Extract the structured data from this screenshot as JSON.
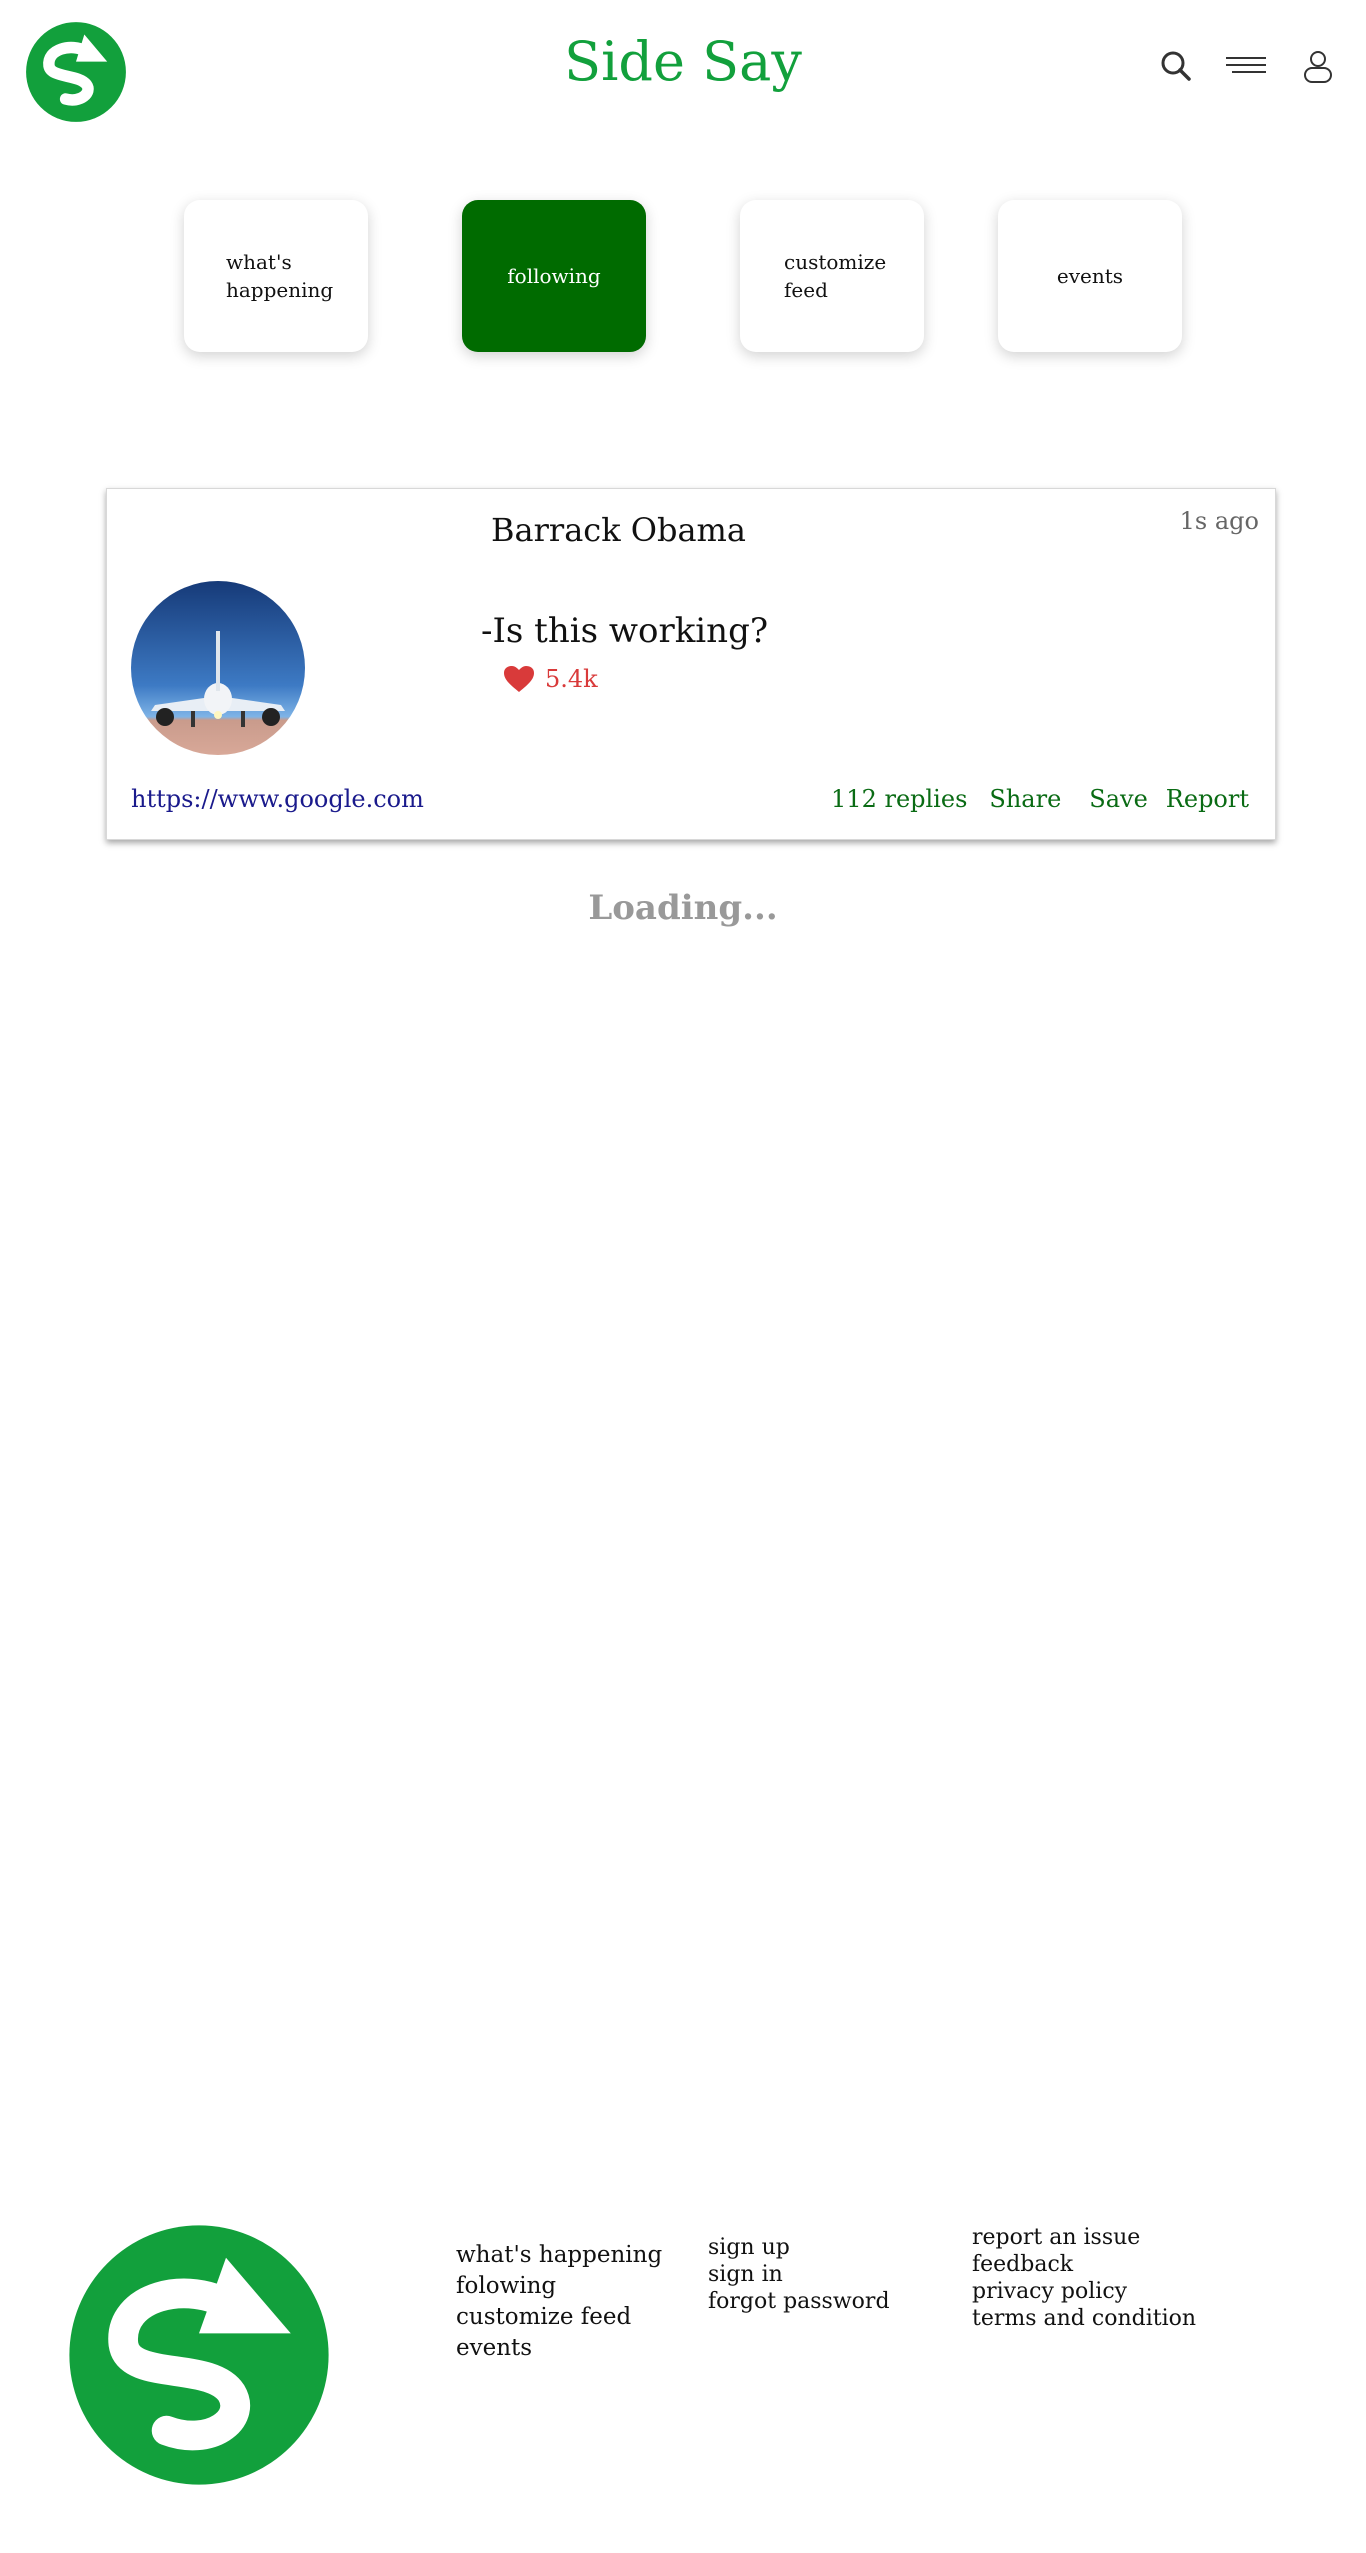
{
  "header": {
    "title": "Side Say",
    "icons": [
      "search-icon",
      "menu-icon",
      "user-icon"
    ]
  },
  "nav": {
    "tiles": [
      {
        "label": "what's happening",
        "active": false
      },
      {
        "label": "following",
        "active": true
      },
      {
        "label": "customize feed",
        "active": false
      },
      {
        "label": "events",
        "active": false
      }
    ]
  },
  "post": {
    "author": "Barrack Obama",
    "time_ago": "1s ago",
    "text": "-Is this working?",
    "likes": "5.4k",
    "link": "https://www.google.com",
    "replies": "112 replies",
    "share": "Share",
    "save": "Save",
    "report": "Report"
  },
  "status": {
    "loading": "Loading..."
  },
  "footer": {
    "col1": [
      "what's happening",
      "folowing",
      "customize feed",
      "events"
    ],
    "col2": [
      "sign up",
      "sign in",
      "forgot password"
    ],
    "col3": [
      "report an issue",
      "feedback",
      "privacy policy",
      "terms and condition"
    ]
  },
  "colors": {
    "brand": "#12a03c",
    "active_tile": "#006b00",
    "action_text": "#0a6b14",
    "like": "#d93a3a",
    "link": "#1a1a8c"
  }
}
